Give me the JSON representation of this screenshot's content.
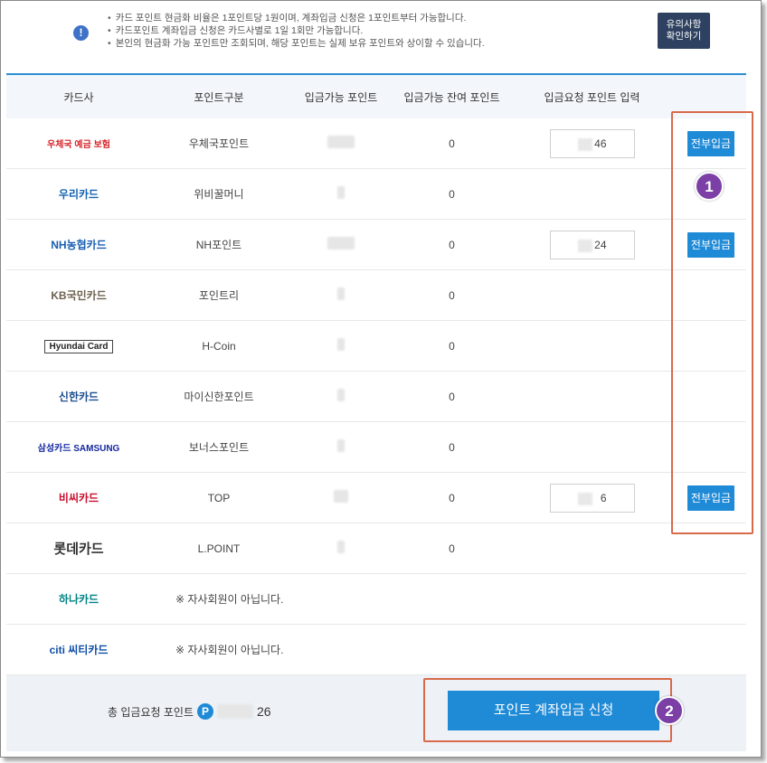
{
  "notice": {
    "icon": "exclamation-icon",
    "lines": [
      "카드 포인트 현금화 비율은 1포인트당 1원이며, 계좌입금 신청은 1포인트부터 가능합니다.",
      "카드포인트 계좌입금 신청은 카드사별로 1일 1회만 가능합니다.",
      "본인의 현금화 가능 포인트만 조회되며, 해당 포인트는 실제 보유 포인트와 상이할 수 있습니다."
    ],
    "button_line1": "유의사항",
    "button_line2": "확인하기"
  },
  "table": {
    "headers": [
      "카드사",
      "포인트구분",
      "입금가능 포인트",
      "입금가능 잔여 포인트",
      "입금요청 포인트 입력",
      ""
    ],
    "rows": [
      {
        "card": "우체국 예금 보험",
        "point_type": "우체국포인트",
        "remain": "0",
        "input": "46",
        "button": "전부입금"
      },
      {
        "card": "우리카드",
        "point_type": "위비꿀머니",
        "remain": "0"
      },
      {
        "card": "NH농협카드",
        "point_type": "NH포인트",
        "remain": "0",
        "input": "24",
        "button": "전부입금"
      },
      {
        "card": "KB국민카드",
        "point_type": "포인트리",
        "remain": "0"
      },
      {
        "card": "Hyundai Card",
        "point_type": "H-Coin",
        "remain": "0"
      },
      {
        "card": "신한카드",
        "point_type": "마이신한포인트",
        "remain": "0"
      },
      {
        "card": "삼성카드 SAMSUNG",
        "point_type": "보너스포인트",
        "remain": "0"
      },
      {
        "card": "비씨카드",
        "point_type": "TOP",
        "remain": "0",
        "input": "6",
        "button": "전부입금"
      },
      {
        "card": "롯데카드",
        "point_type": "L.POINT",
        "remain": "0"
      },
      {
        "card": "하나카드",
        "nonmember": "※ 자사회원이 아닙니다."
      },
      {
        "card": "citi 씨티카드",
        "nonmember": "※ 자사회원이 아닙니다."
      }
    ]
  },
  "footer": {
    "total_label": "총 입금요청 포인트",
    "badge": "P",
    "total_value": "26",
    "submit": "포인트 계좌입금 신청"
  },
  "steps": [
    "1",
    "2"
  ],
  "colors": {
    "accent": "#1f8ad6",
    "highlight": "#d86a4a",
    "step": "#7b3fa6"
  }
}
